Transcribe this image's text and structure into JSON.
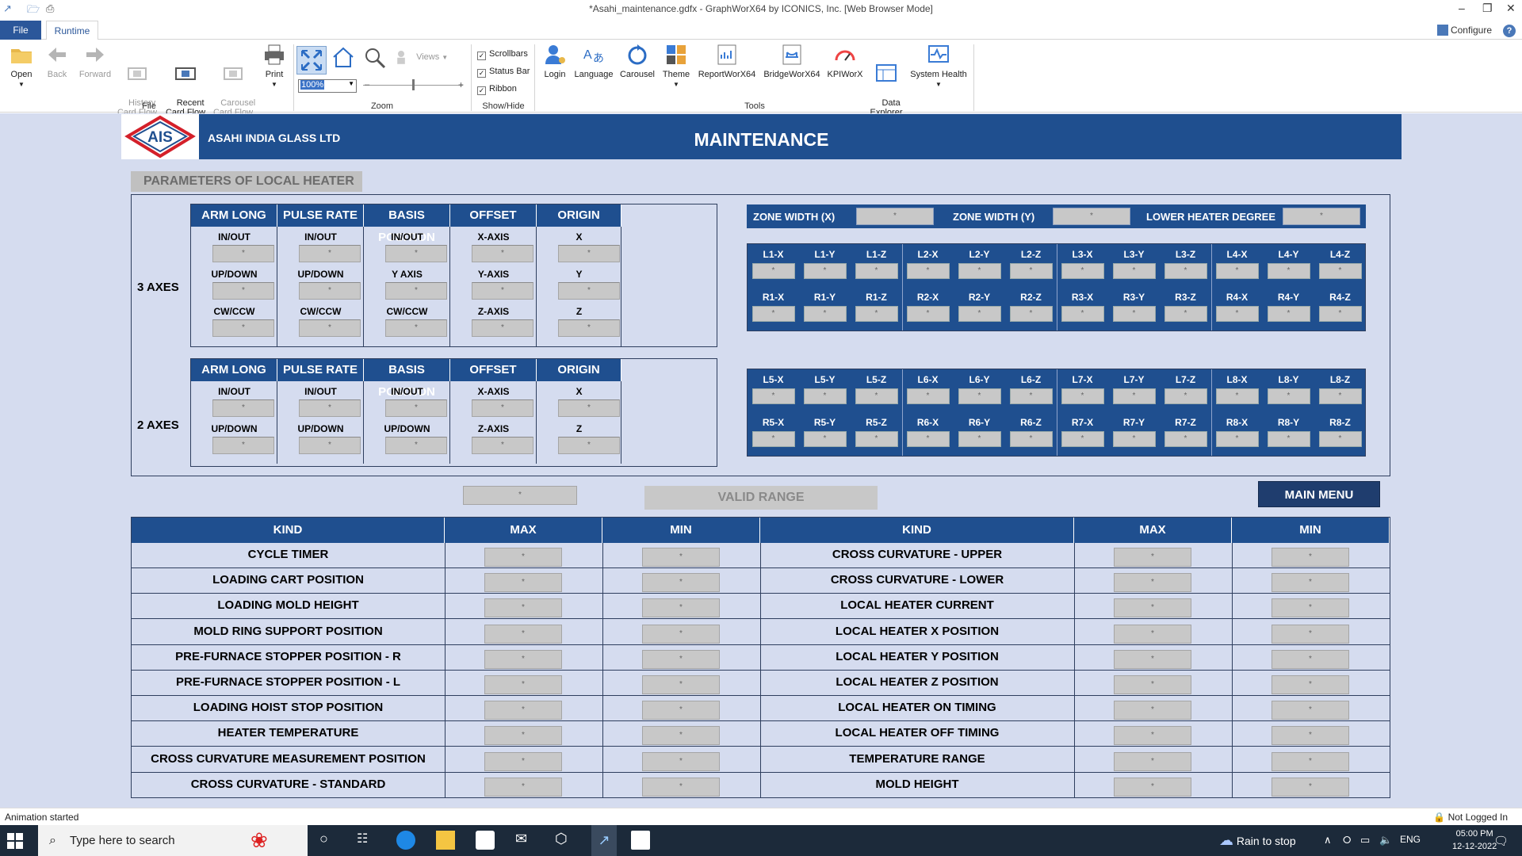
{
  "window": {
    "title": "*Asahi_maintenance.gdfx - GraphWorX64 by ICONICS, Inc. [Web Browser Mode]"
  },
  "tabs": {
    "file": "File",
    "runtime": "Runtime"
  },
  "configure": "Configure",
  "ribbon": {
    "open": "Open",
    "back": "Back",
    "forward": "Forward",
    "history": "History\nCard Flow",
    "recent": "Recent\nCard Flow",
    "carousel_flow": "Carousel\nCard Flow",
    "print": "Print",
    "views": "Views",
    "zoom_value": "100%",
    "scrollbars": "Scrollbars",
    "statusbar": "Status Bar",
    "ribbon": "Ribbon",
    "login": "Login",
    "language": "Language",
    "carousel": "Carousel",
    "theme": "Theme",
    "reportworx": "ReportWorX64",
    "bridgeworx": "BridgeWorX64",
    "kpiworx": "KPIWorX",
    "data_explorer": "Data\nExplorer",
    "system_health": "System Health",
    "groups": {
      "file": "File",
      "zoom": "Zoom",
      "showhide": "Show/Hide",
      "tools": "Tools"
    }
  },
  "header": {
    "logo": "AIS",
    "company": "ASAHI INDIA GLASS LTD",
    "title": "MAINTENANCE"
  },
  "params_title": "PARAMETERS OF LOCAL HEATER",
  "axes3": {
    "label": "3 AXES",
    "headers": [
      "ARM LONG",
      "PULSE RATE",
      "BASIS POSITION",
      "OFFSET",
      "ORIGIN"
    ],
    "columns": [
      [
        "IN/OUT",
        "UP/DOWN",
        "CW/CCW"
      ],
      [
        "IN/OUT",
        "UP/DOWN",
        "CW/CCW"
      ],
      [
        "IN/OUT",
        "Y AXIS",
        "CW/CCW"
      ],
      [
        "X-AXIS",
        "Y-AXIS",
        "Z-AXIS"
      ],
      [
        "X",
        "Y",
        "Z"
      ]
    ]
  },
  "axes2": {
    "label": "2 AXES",
    "headers": [
      "ARM LONG",
      "PULSE RATE",
      "BASIS POSITION",
      "OFFSET",
      "ORIGIN"
    ],
    "columns": [
      [
        "IN/OUT",
        "UP/DOWN"
      ],
      [
        "IN/OUT",
        "UP/DOWN"
      ],
      [
        "IN/OUT",
        "UP/DOWN"
      ],
      [
        "X-AXIS",
        "Z-AXIS"
      ],
      [
        "X",
        "Z"
      ]
    ]
  },
  "zone": {
    "width_x": "ZONE WIDTH (X)",
    "width_y": "ZONE WIDTH (Y)",
    "lower_heater": "LOWER HEATER DEGREE"
  },
  "grid1": {
    "top": [
      "L1-X",
      "L1-Y",
      "L1-Z",
      "L2-X",
      "L2-Y",
      "L2-Z",
      "L3-X",
      "L3-Y",
      "L3-Z",
      "L4-X",
      "L4-Y",
      "L4-Z"
    ],
    "bottom": [
      "R1-X",
      "R1-Y",
      "R1-Z",
      "R2-X",
      "R2-Y",
      "R2-Z",
      "R3-X",
      "R3-Y",
      "R3-Z",
      "R4-X",
      "R4-Y",
      "R4-Z"
    ]
  },
  "grid2": {
    "top": [
      "L5-X",
      "L5-Y",
      "L5-Z",
      "L6-X",
      "L6-Y",
      "L6-Z",
      "L7-X",
      "L7-Y",
      "L7-Z",
      "L8-X",
      "L8-Y",
      "L8-Z"
    ],
    "bottom": [
      "R5-X",
      "R5-Y",
      "R5-Z",
      "R6-X",
      "R6-Y",
      "R6-Z",
      "R7-X",
      "R7-Y",
      "R7-Z",
      "R8-X",
      "R8-Y",
      "R8-Z"
    ]
  },
  "field_placeholder": "*",
  "valid_range": "VALID RANGE",
  "main_menu": "MAIN MENU",
  "range_table": {
    "headers": [
      "KIND",
      "MAX",
      "MIN",
      "KIND",
      "MAX",
      "MIN"
    ],
    "left_kinds": [
      "CYCLE TIMER",
      "LOADING CART POSITION",
      "LOADING MOLD HEIGHT",
      "MOLD RING SUPPORT POSITION",
      "PRE-FURNACE STOPPER POSITION - R",
      "PRE-FURNACE STOPPER POSITION - L",
      "LOADING HOIST STOP POSITION",
      "HEATER TEMPERATURE",
      "CROSS CURVATURE MEASUREMENT POSITION",
      "CROSS CURVATURE - STANDARD"
    ],
    "right_kinds": [
      "CROSS CURVATURE - UPPER",
      "CROSS CURVATURE - LOWER",
      "LOCAL HEATER CURRENT",
      "LOCAL HEATER X POSITION",
      "LOCAL HEATER Y POSITION",
      "LOCAL HEATER Z POSITION",
      "LOCAL HEATER ON TIMING",
      "LOCAL HEATER OFF TIMING",
      "TEMPERATURE RANGE",
      "MOLD HEIGHT"
    ]
  },
  "status": {
    "left": "Animation started",
    "right": "Not Logged In"
  },
  "taskbar": {
    "search": "Type here to search",
    "weather": "Rain to stop",
    "lang": "ENG",
    "time": "05:00 PM",
    "date": "12-12-2022"
  },
  "colors": {
    "header_blue": "#1f4f8f",
    "canvas": "#d5dcef",
    "field_grey": "#c8c8c8",
    "ribbon_blue": "#2b579a"
  }
}
